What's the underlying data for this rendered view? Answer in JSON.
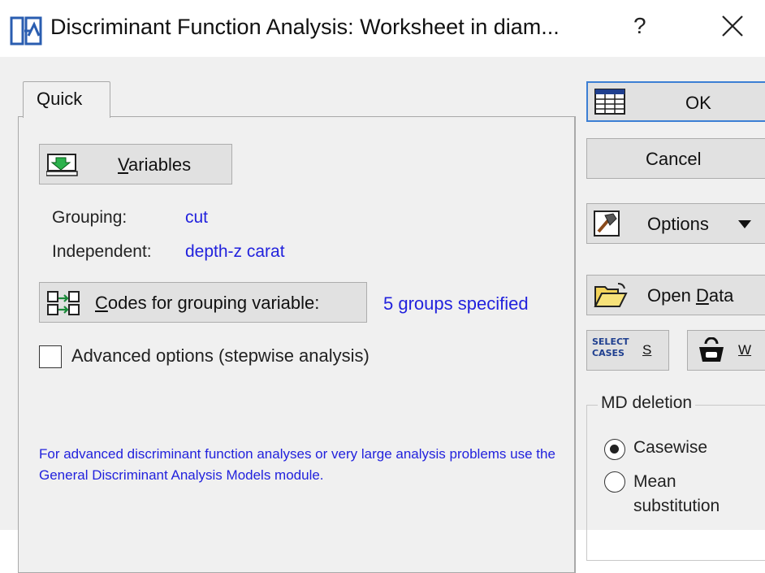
{
  "window": {
    "title": "Discriminant Function Analysis: Worksheet in diam...",
    "help": "?",
    "close_icon": "close-icon"
  },
  "tabs": [
    {
      "label": "Quick"
    }
  ],
  "quick": {
    "variables_button": {
      "pre": "",
      "underline": "V",
      "post": "ariables"
    },
    "grouping_label": "Grouping:",
    "grouping_value": "cut",
    "independent_label": "Independent:",
    "independent_value": "depth-z carat",
    "codes_button": {
      "underline": "C",
      "post": "odes for grouping variable:"
    },
    "codes_status": "5 groups specified",
    "advanced_checkbox": {
      "label": "Advanced options (stepwise analysis)",
      "checked": false
    },
    "info_text": "For advanced discriminant function analyses or very large analysis problems use the General Discriminant Analysis Models module."
  },
  "side": {
    "ok_label": "OK",
    "cancel_label": "Cancel",
    "options_label": "Options",
    "open_data": {
      "pre": "Open ",
      "underline": "D",
      "post": "ata"
    },
    "select_cases_icon_text": [
      "SELECT",
      "CASES"
    ],
    "select_cases_short": "S",
    "weights_short": "W",
    "md_deletion": {
      "title": "MD deletion",
      "options": [
        {
          "label": "Casewise",
          "selected": true
        },
        {
          "label": "Mean",
          "label2": "substitution",
          "selected": false
        }
      ]
    }
  },
  "colors": {
    "link_blue": "#2222dd",
    "dialog_bg": "#f0f0f0",
    "button_bg": "#e1e1e1"
  }
}
